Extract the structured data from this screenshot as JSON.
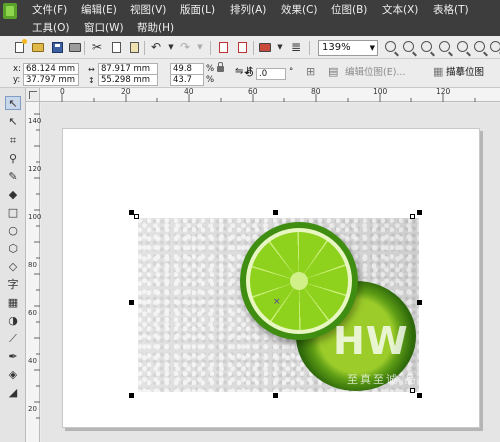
{
  "menu": {
    "row1": [
      "文件(F)",
      "编辑(E)",
      "视图(V)",
      "版面(L)",
      "排列(A)",
      "效果(C)",
      "位图(B)",
      "文本(X)",
      "表格(T)"
    ],
    "row2": [
      "工具(O)",
      "窗口(W)",
      "帮助(H)"
    ]
  },
  "toolbar": {
    "zoom_value": "139%",
    "icons": [
      "new-document-icon",
      "open-icon",
      "save-icon",
      "print-icon",
      "cut-icon",
      "copy-icon",
      "paste-icon",
      "undo-icon",
      "redo-icon",
      "import-icon",
      "export-icon",
      "application-launcher-icon",
      "welcome-screen-icon",
      "zoom-in-icon",
      "zoom-out-icon",
      "zoom-selected-icon",
      "zoom-all-icon",
      "zoom-page-icon",
      "zoom-width-icon",
      "zoom-height-icon"
    ]
  },
  "propbar": {
    "x_label": "x:",
    "x_value": "68.124 mm",
    "y_label": "y:",
    "y_value": "37.797 mm",
    "width_value": "87.917 mm",
    "height_value": "55.298 mm",
    "scale_w": "49.8",
    "scale_h": "43.7",
    "percent": "%",
    "rotation": ".0",
    "degree": "°",
    "edit_bitmap": "编辑位图(E)...",
    "trace_bitmap": "描摹位图"
  },
  "ruler": {
    "h_labels": [
      "0",
      "20",
      "40",
      "60",
      "80",
      "100",
      "120"
    ],
    "v_labels": [
      "140",
      "120",
      "100",
      "80",
      "60",
      "40",
      "20"
    ],
    "unit": "毫米"
  },
  "toolbox": {
    "tools": [
      "pick-tool-icon",
      "shape-tool-icon",
      "crop-tool-icon",
      "zoom-tool-icon",
      "freehand-tool-icon",
      "smart-fill-icon",
      "rectangle-tool-icon",
      "ellipse-tool-icon",
      "polygon-tool-icon",
      "basic-shapes-icon",
      "text-tool-icon",
      "table-tool-icon",
      "interactive-blend-icon",
      "eyedropper-icon",
      "outline-pen-icon",
      "fill-tool-icon",
      "interactive-fill-icon"
    ],
    "text_tool": "字"
  },
  "watermark": {
    "main": "HW",
    "sub": "至真至诚 品"
  },
  "colors": {
    "menubar_bg": "#3d3d3d",
    "lime_green": "#8fd21e",
    "selection_handle": "#000000"
  }
}
